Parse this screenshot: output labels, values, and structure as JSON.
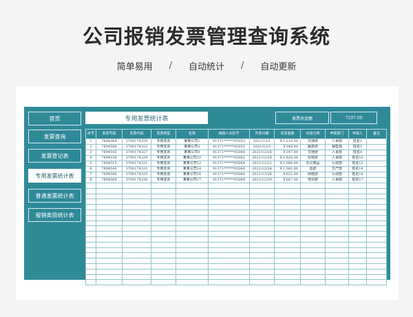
{
  "headline": "公司报销发票管理查询系统",
  "taglines": [
    "简单易用",
    "自动统计",
    "自动更新"
  ],
  "separator": "/",
  "nav": [
    {
      "label": "首页",
      "active": false
    },
    {
      "label": "发票查询",
      "active": false
    },
    {
      "label": "发票登记表",
      "active": false
    },
    {
      "label": "专用发票统计表",
      "active": true
    },
    {
      "label": "普通发票统计表",
      "active": false
    },
    {
      "label": "报销类目统计表",
      "active": false
    }
  ],
  "sheet_title": "专用发票统计表",
  "total": {
    "label": "发票总金额",
    "value": "7297.00"
  },
  "columns": [
    "序号",
    "发票号码",
    "发票代码",
    "发票类型",
    "名称",
    "纳税人识别号",
    "开票日期",
    "发票金额",
    "内容分类",
    "申报部门",
    "申报人",
    "备注"
  ],
  "rows": [
    [
      "1",
      "7894564",
      "3700174320",
      "专用发票",
      "某某公司1",
      "91371******05053",
      "2021/12/1",
      "￥1,210.00",
      "交通费",
      "人事部",
      "姓名1",
      ""
    ],
    [
      "2",
      "7894588",
      "3700174322",
      "专用发票",
      "某某公司3",
      "91371******05055",
      "2021/12/3",
      "￥348.00",
      "差旅费",
      "销售部",
      "姓名3",
      ""
    ],
    [
      "3",
      "7894543",
      "3700174327",
      "专用发票",
      "某某公司8",
      "91371******05060",
      "2021/12/16",
      "￥147.00",
      "交通费",
      "人事部",
      "姓名8",
      ""
    ],
    [
      "4",
      "7894558",
      "3700174329",
      "专用发票",
      "某某公司10",
      "91371******05062",
      "2021/12/18",
      "￥1,826.00",
      "招待费",
      "人事部",
      "姓名10",
      ""
    ],
    [
      "5",
      "7894515",
      "3700174331",
      "专用发票",
      "某某公司12",
      "91371******05064",
      "2021/12/22",
      "￥1,086.00",
      "办公用品",
      "行政部",
      "姓名12",
      ""
    ],
    [
      "6",
      "7894540",
      "3700174333",
      "专用发票",
      "某某公司14",
      "91371******05066",
      "2021/12/24",
      "￥1,361.00",
      "运费",
      "生产部",
      "姓名14",
      ""
    ],
    [
      "7",
      "7894586",
      "3700174335",
      "专用发票",
      "某某公司16",
      "91371******05068",
      "2021/12/26",
      "￥632.00",
      "网络费",
      "行政部",
      "姓名16",
      ""
    ],
    [
      "8",
      "7894569",
      "3700174336",
      "专用发票",
      "某某公司17",
      "91371******05069",
      "2021/12/29",
      "￥687.00",
      "培训费",
      "人事部",
      "姓名17",
      ""
    ]
  ],
  "empty_rows": 19,
  "colors": {
    "panel": "#2f8a98",
    "grid_line": "#8fc3cb",
    "text_dark": "#1d3c42"
  }
}
